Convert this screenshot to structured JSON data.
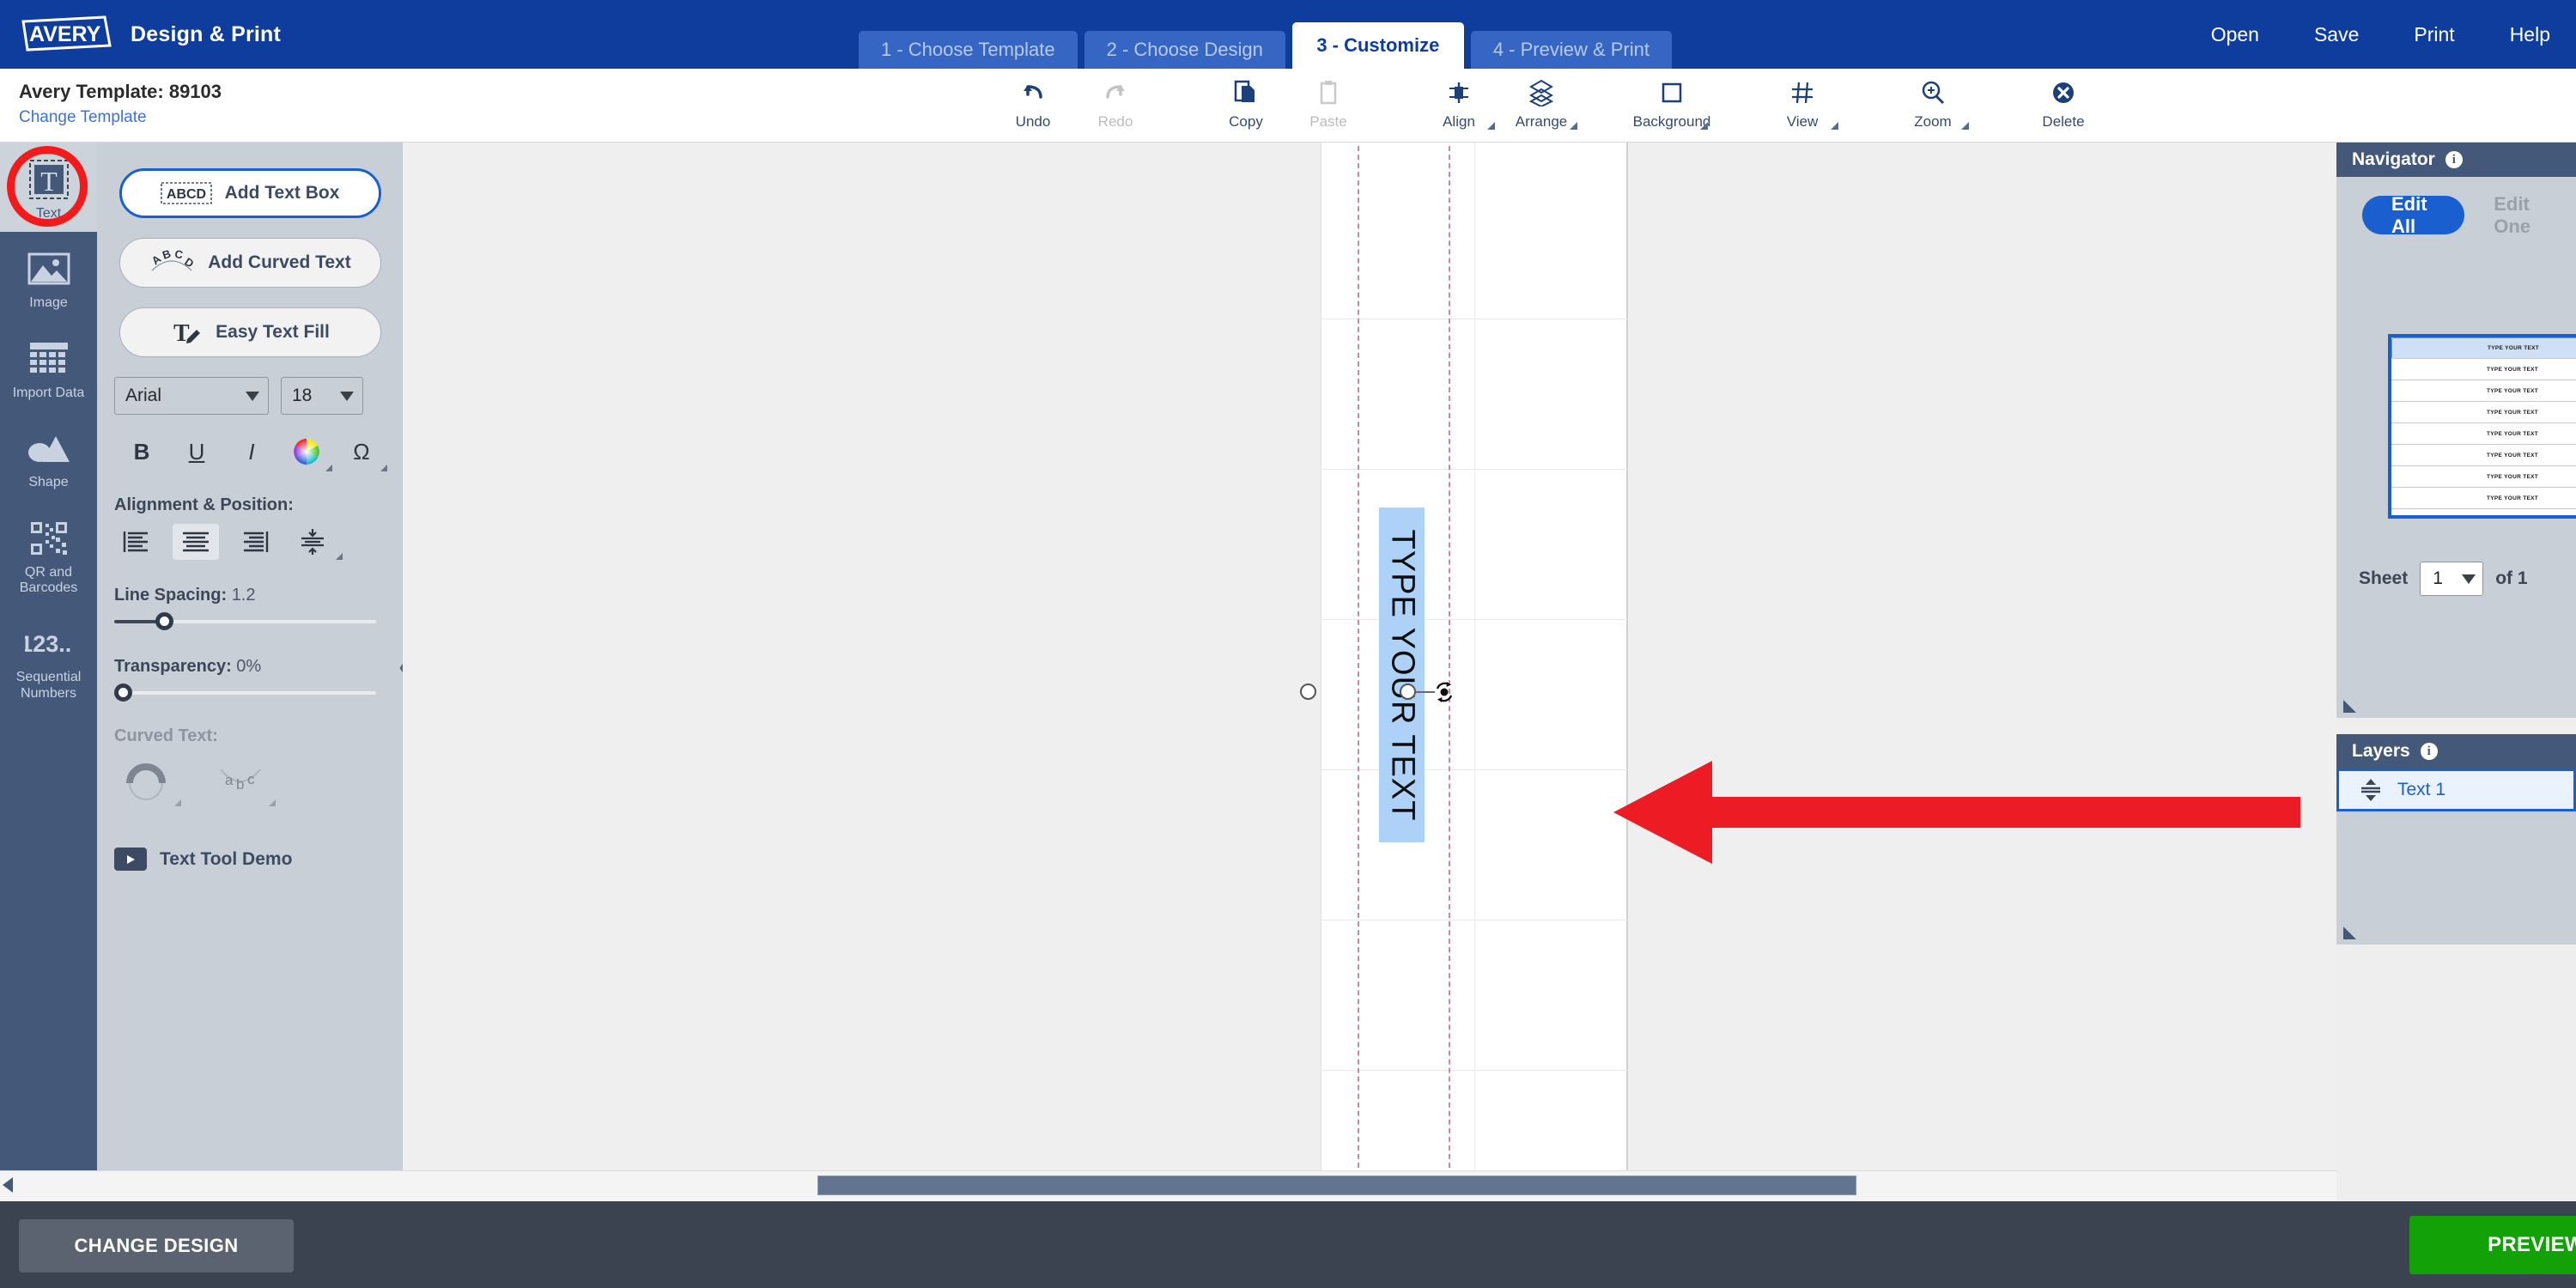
{
  "header": {
    "brand_title": "Design & Print",
    "logo_text": "AVERY",
    "steps": [
      {
        "label": "1 - Choose Template",
        "active": false
      },
      {
        "label": "2 - Choose Design",
        "active": false
      },
      {
        "label": "3 - Customize",
        "active": true
      },
      {
        "label": "4 - Preview & Print",
        "active": false
      }
    ],
    "menu": [
      "Open",
      "Save",
      "Print",
      "Help"
    ]
  },
  "template_bar": {
    "template_label": "Avery Template: 89103",
    "change_template": "Change Template"
  },
  "toolbar": [
    {
      "label": "Undo",
      "icon": "undo-arrow-icon",
      "disabled": false,
      "caret": false
    },
    {
      "label": "Redo",
      "icon": "redo-arrow-icon",
      "disabled": true,
      "caret": false
    },
    {
      "label": "Copy",
      "icon": "copy-pages-icon",
      "disabled": false,
      "caret": false
    },
    {
      "label": "Paste",
      "icon": "paste-clipboard-icon",
      "disabled": true,
      "caret": false
    },
    {
      "label": "Align",
      "icon": "align-center-icon",
      "disabled": false,
      "caret": true
    },
    {
      "label": "Arrange",
      "icon": "arrange-stack-icon",
      "disabled": false,
      "caret": true
    },
    {
      "label": "Background",
      "icon": "background-square-icon",
      "disabled": false,
      "caret": true
    },
    {
      "label": "View",
      "icon": "view-grid-icon",
      "disabled": false,
      "caret": true
    },
    {
      "label": "Zoom",
      "icon": "zoom-magnifier-icon",
      "disabled": false,
      "caret": true
    },
    {
      "label": "Delete",
      "icon": "delete-x-circle-icon",
      "disabled": false,
      "caret": false
    }
  ],
  "sidebar": {
    "items": [
      {
        "label": "Text",
        "icon": "text-t-icon",
        "active": true
      },
      {
        "label": "Image",
        "icon": "image-mountain-icon",
        "active": false
      },
      {
        "label": "Import Data",
        "icon": "import-data-table-icon",
        "active": false
      },
      {
        "label": "Shape",
        "icon": "shape-circle-triangle-icon",
        "active": false
      },
      {
        "label": "QR and Barcodes",
        "icon": "qr-barcode-icon",
        "active": false
      },
      {
        "label": "Sequential Numbers",
        "icon": "sequential-numbers-icon",
        "active": false
      }
    ]
  },
  "text_panel": {
    "buttons": [
      {
        "label": "Add Text Box",
        "icon": "abcd-box-icon",
        "primary": true
      },
      {
        "label": "Add Curved Text",
        "icon": "curved-abc-icon",
        "primary": false
      },
      {
        "label": "Easy Text Fill",
        "icon": "text-fill-pencil-icon",
        "primary": false
      }
    ],
    "font_family": "Arial",
    "font_size": "18",
    "style_buttons": [
      {
        "label": "B",
        "name": "bold-button",
        "caret": false
      },
      {
        "label": "U",
        "name": "underline-button",
        "caret": false
      },
      {
        "label": "I",
        "name": "italic-button",
        "caret": false
      },
      {
        "label": "",
        "name": "text-color-wheel-button",
        "caret": true
      },
      {
        "label": "Ω",
        "name": "special-character-button",
        "caret": true
      }
    ],
    "alignment_label": "Alignment & Position:",
    "alignment_buttons": [
      {
        "name": "align-left-button",
        "selected": false,
        "caret": false
      },
      {
        "name": "align-center-button",
        "selected": true,
        "caret": false
      },
      {
        "name": "align-right-button",
        "selected": false,
        "caret": false
      },
      {
        "name": "vertical-position-button",
        "selected": false,
        "caret": true
      }
    ],
    "line_spacing_label": "Line Spacing:",
    "line_spacing_value": "1.2",
    "line_spacing_percent": 19,
    "transparency_label": "Transparency:",
    "transparency_value": "0%",
    "transparency_percent": 0,
    "curved_text_label": "Curved Text:",
    "curved_buttons": [
      {
        "name": "curve-arc-button"
      },
      {
        "name": "curve-abc-button"
      }
    ],
    "demo_label": "Text Tool Demo",
    "collapse_icon": "chevron-left-icon"
  },
  "canvas": {
    "text_object": {
      "value": "TYPE YOUR TEXT",
      "rotation_deg": 90
    }
  },
  "navigator": {
    "title": "Navigator",
    "tabs": [
      {
        "label": "Edit All",
        "active": true
      },
      {
        "label": "Edit One",
        "active": false
      }
    ],
    "thumbnail_rows": [
      "TYPE YOUR TEXT",
      "TYPE YOUR TEXT",
      "TYPE YOUR TEXT",
      "TYPE YOUR TEXT",
      "TYPE YOUR TEXT",
      "TYPE YOUR TEXT",
      "TYPE YOUR TEXT",
      "TYPE YOUR TEXT"
    ],
    "sheet_prefix": "Sheet",
    "sheet_value": "1",
    "sheet_suffix": "of 1"
  },
  "layers": {
    "title": "Layers",
    "items": [
      {
        "label": "Text 1",
        "icon": "layer-text-lines-icon",
        "selected": true
      }
    ]
  },
  "bottom": {
    "change_design": "CHANGE DESIGN",
    "preview_print": "PREVIEW & PRINT"
  },
  "annotation": {
    "arrow_color": "#ed1c24",
    "circle_color": "#f21a1a"
  },
  "colors": {
    "brand_blue": "#0f3d9e",
    "accent_blue": "#1a5fd0",
    "panel_gray": "#c9cfd7",
    "rail_navy": "#44587a",
    "green": "#13a108"
  }
}
